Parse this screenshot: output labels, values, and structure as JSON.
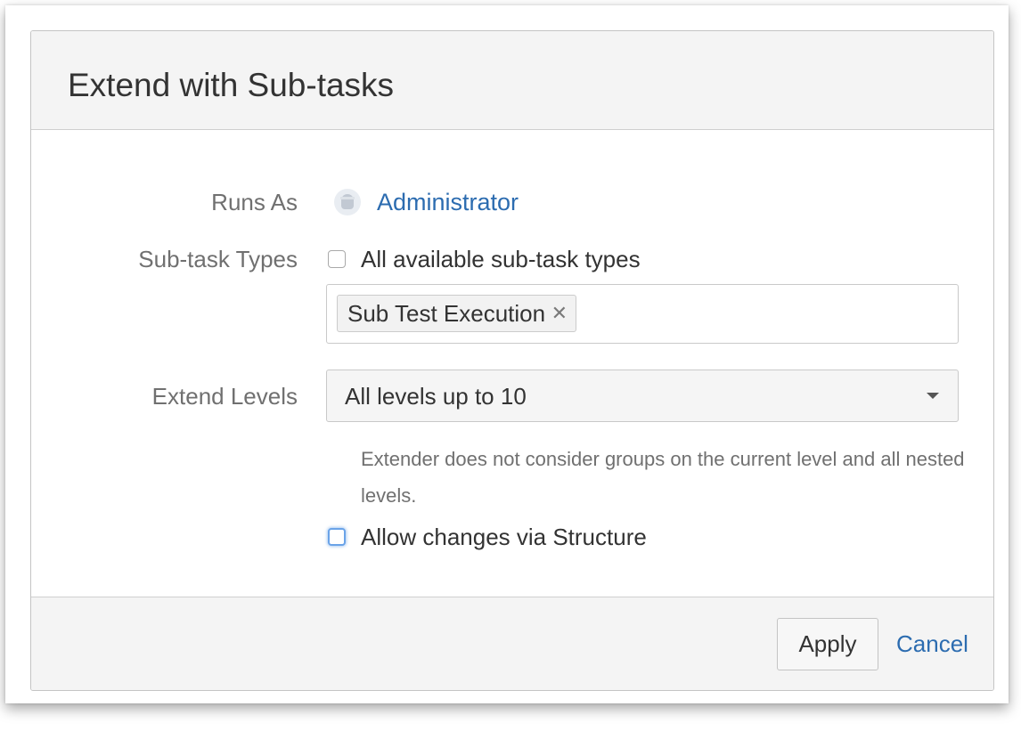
{
  "dialog": {
    "title": "Extend with Sub-tasks"
  },
  "runs_as": {
    "label": "Runs As",
    "user": "Administrator",
    "avatar_icon": "user-avatar-icon"
  },
  "subtask_types": {
    "label": "Sub-task Types",
    "all_available_label": "All available sub-task types",
    "all_available_checked": false,
    "selected_tokens": [
      {
        "label": "Sub Test Execution",
        "remove_glyph": "✕"
      }
    ]
  },
  "extend_levels": {
    "label": "Extend Levels",
    "selected_value": "All levels up to 10",
    "help_text": "Extender does not consider groups on the current level and all nested levels."
  },
  "allow_changes": {
    "label": "Allow changes via Structure",
    "checked": false
  },
  "footer": {
    "apply_label": "Apply",
    "cancel_label": "Cancel"
  },
  "colors": {
    "link": "#2c6cb0",
    "label": "#707070",
    "text": "#333333",
    "header_bg": "#f4f4f4",
    "focus_ring": "#6aa3e8"
  }
}
